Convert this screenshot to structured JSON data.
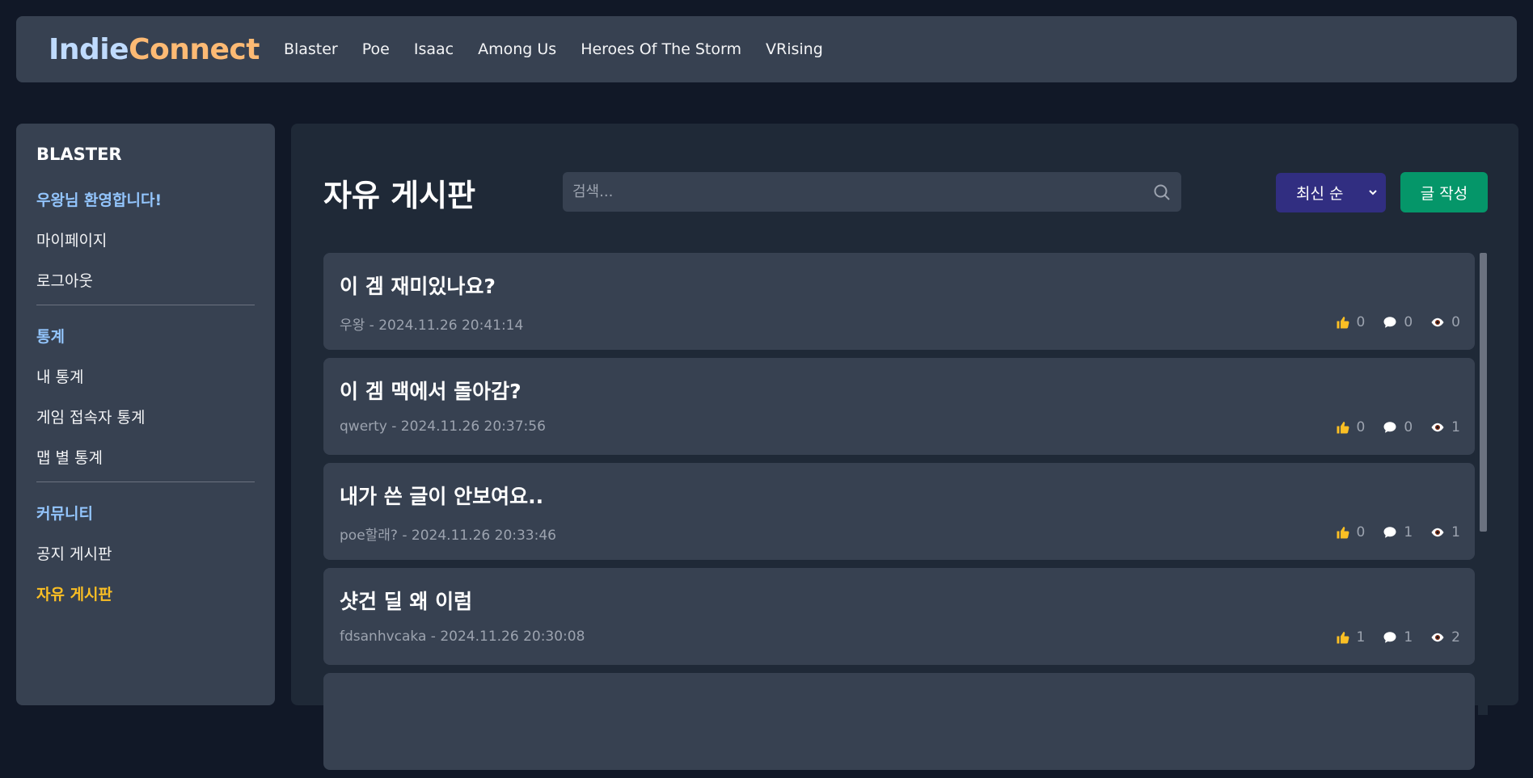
{
  "logo": {
    "part1": "Indie",
    "part2": "Connect"
  },
  "nav": [
    "Blaster",
    "Poe",
    "Isaac",
    "Among Us",
    "Heroes Of The Storm",
    "VRising"
  ],
  "sidebar": {
    "title": "BLASTER",
    "welcome": "우왕님 환영합니다!",
    "account": [
      "마이페이지",
      "로그아웃"
    ],
    "stats_section": "통계",
    "stats": [
      "내 통계",
      "게임 접속자 통계",
      "맵 별 통계"
    ],
    "community_section": "커뮤니티",
    "community": [
      "공지 게시판",
      "자유 게시판"
    ]
  },
  "main": {
    "title": "자유 게시판",
    "search_placeholder": "검색...",
    "sort_label": "최신 순",
    "write_label": "글 작성"
  },
  "posts": [
    {
      "title": "이 겜 재미있나요?",
      "meta": "우왕 - 2024.11.26 20:41:14",
      "likes": "0",
      "comments": "0",
      "views": "0"
    },
    {
      "title": "이 겜 맥에서 돌아감?",
      "meta": "qwerty - 2024.11.26 20:37:56",
      "likes": "0",
      "comments": "0",
      "views": "1"
    },
    {
      "title": "내가 쓴 글이 안보여요..",
      "meta": "poe할래? - 2024.11.26 20:33:46",
      "likes": "0",
      "comments": "1",
      "views": "1"
    },
    {
      "title": "샷건 딜 왜 이럼",
      "meta": "fdsanhvcaka - 2024.11.26 20:30:08",
      "likes": "1",
      "comments": "1",
      "views": "2"
    }
  ],
  "colors": {
    "accent_blue": "#93c5fd",
    "accent_orange": "#fdba74",
    "active_item": "#fbbf24",
    "write_button": "#059669",
    "sort_button": "#312e81"
  }
}
